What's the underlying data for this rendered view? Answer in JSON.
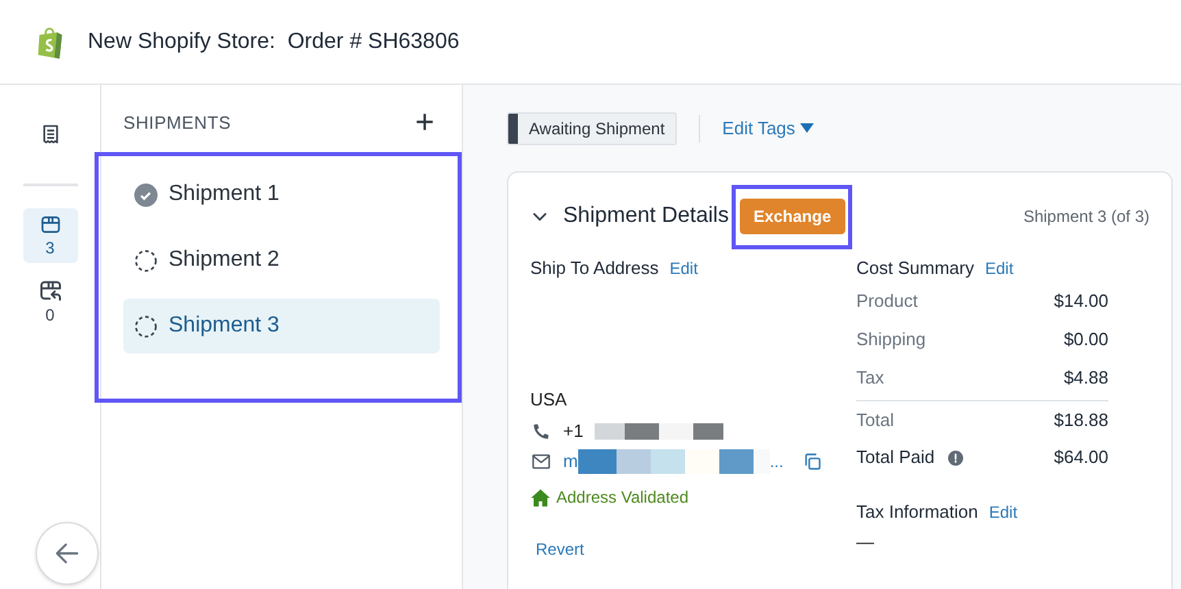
{
  "header": {
    "title": "New Shopify Store:  Order # SH63806"
  },
  "rail": [
    {
      "kind": "receipt",
      "selected": false
    },
    {
      "kind": "box",
      "count": "3",
      "selected": true
    },
    {
      "kind": "return",
      "count": "0",
      "selected": false
    }
  ],
  "shipments": {
    "title": "SHIPMENTS",
    "add": "+",
    "items": [
      {
        "label": "Shipment 1",
        "kind": "complete",
        "selected": false
      },
      {
        "label": "Shipment 2",
        "kind": "pending",
        "selected": false
      },
      {
        "label": "Shipment 3",
        "kind": "pending",
        "selected": true
      }
    ]
  },
  "tag": {
    "label": "Awaiting Shipment"
  },
  "edit_tags": "Edit Tags",
  "card": {
    "title": "Shipment Details",
    "badge": "Exchange",
    "counter": "Shipment 3 (of 3)",
    "address": {
      "title": "Ship To Address",
      "edit": "Edit",
      "country": "USA",
      "phone": "+1",
      "email_start": "m",
      "email_end": "...",
      "validated": "Address Validated",
      "revert": "Revert"
    },
    "cost": {
      "title": "Cost Summary",
      "edit": "Edit",
      "rows": [
        {
          "label": "Product",
          "value": "$14.00",
          "kind": "line"
        },
        {
          "label": "Shipping",
          "value": "$0.00",
          "kind": "line"
        },
        {
          "label": "Tax",
          "value": "$4.88",
          "kind": "line"
        },
        {
          "label": "Total",
          "value": "$18.88",
          "kind": "total"
        },
        {
          "label": "Total Paid",
          "value": "$64.00",
          "kind": "paid"
        }
      ]
    },
    "tax": {
      "title": "Tax Information",
      "edit": "Edit",
      "value": "—"
    }
  }
}
